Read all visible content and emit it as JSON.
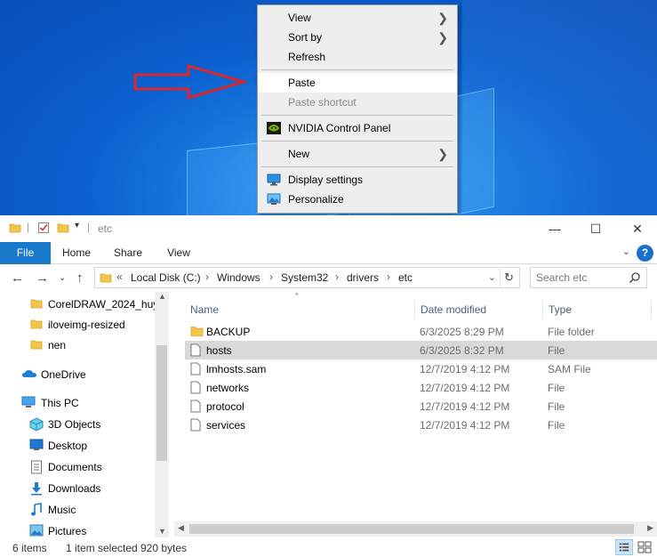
{
  "context_menu": {
    "items": [
      {
        "label": "View",
        "submenu": true
      },
      {
        "label": "Sort by",
        "submenu": true
      },
      {
        "label": "Refresh"
      },
      {
        "label": "Paste",
        "highlighted": true
      },
      {
        "label": "Paste shortcut",
        "disabled": true
      },
      {
        "label": "NVIDIA Control Panel",
        "icon": "nvidia-icon"
      },
      {
        "label": "New",
        "submenu": true
      },
      {
        "label": "Display settings",
        "icon": "display-icon"
      },
      {
        "label": "Personalize",
        "icon": "personalize-icon"
      }
    ]
  },
  "annotation": {
    "arrow_color": "#d9262c",
    "icon": "red-arrow-icon"
  },
  "explorer": {
    "title": "etc",
    "ribbon_tabs": [
      "File",
      "Home",
      "Share",
      "View"
    ],
    "help": "?",
    "address": {
      "prefix": "«",
      "crumbs": [
        "Local Disk (C:)",
        "Windows",
        "System32",
        "drivers",
        "etc"
      ]
    },
    "search_placeholder": "Search etc",
    "nav_items": [
      {
        "label": "CorelDRAW_2024_huyn",
        "icon": "folder-icon"
      },
      {
        "label": "iloveimg-resized",
        "icon": "folder-icon"
      },
      {
        "label": "nen",
        "icon": "folder-icon"
      },
      {
        "label": "OneDrive",
        "icon": "onedrive-icon"
      },
      {
        "label": "This PC",
        "icon": "this-pc-icon"
      },
      {
        "label": "3D Objects",
        "icon": "3d-objects-icon"
      },
      {
        "label": "Desktop",
        "icon": "desktop-icon"
      },
      {
        "label": "Documents",
        "icon": "documents-icon"
      },
      {
        "label": "Downloads",
        "icon": "downloads-icon"
      },
      {
        "label": "Music",
        "icon": "music-icon"
      },
      {
        "label": "Pictures",
        "icon": "pictures-icon"
      }
    ],
    "columns": [
      "Name",
      "Date modified",
      "Type",
      "S"
    ],
    "files": [
      {
        "name": "BACKUP",
        "date": "6/3/2025 8:29 PM",
        "type": "File folder",
        "icon": "folder-icon"
      },
      {
        "name": "hosts",
        "date": "6/3/2025 8:32 PM",
        "type": "File",
        "icon": "file-icon",
        "selected": true
      },
      {
        "name": "lmhosts.sam",
        "date": "12/7/2019 4:12 PM",
        "type": "SAM File",
        "icon": "file-icon"
      },
      {
        "name": "networks",
        "date": "12/7/2019 4:12 PM",
        "type": "File",
        "icon": "file-icon"
      },
      {
        "name": "protocol",
        "date": "12/7/2019 4:12 PM",
        "type": "File",
        "icon": "file-icon"
      },
      {
        "name": "services",
        "date": "12/7/2019 4:12 PM",
        "type": "File",
        "icon": "file-icon"
      }
    ],
    "status": {
      "items": "6 items",
      "selected": "1 item selected",
      "size": "920 bytes"
    }
  },
  "colors": {
    "accent": "#1979ca",
    "folder": "#f3c64a",
    "selection": "#d9d9d9",
    "menu_bg": "#eeeeee"
  }
}
